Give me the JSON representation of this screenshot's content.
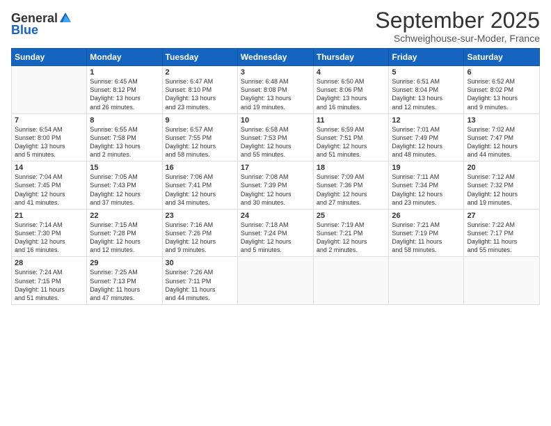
{
  "logo": {
    "general": "General",
    "blue": "Blue"
  },
  "header": {
    "month": "September 2025",
    "location": "Schweighouse-sur-Moder, France"
  },
  "days_of_week": [
    "Sunday",
    "Monday",
    "Tuesday",
    "Wednesday",
    "Thursday",
    "Friday",
    "Saturday"
  ],
  "weeks": [
    [
      {
        "day": "",
        "content": ""
      },
      {
        "day": "1",
        "content": "Sunrise: 6:45 AM\nSunset: 8:12 PM\nDaylight: 13 hours\nand 26 minutes."
      },
      {
        "day": "2",
        "content": "Sunrise: 6:47 AM\nSunset: 8:10 PM\nDaylight: 13 hours\nand 23 minutes."
      },
      {
        "day": "3",
        "content": "Sunrise: 6:48 AM\nSunset: 8:08 PM\nDaylight: 13 hours\nand 19 minutes."
      },
      {
        "day": "4",
        "content": "Sunrise: 6:50 AM\nSunset: 8:06 PM\nDaylight: 13 hours\nand 16 minutes."
      },
      {
        "day": "5",
        "content": "Sunrise: 6:51 AM\nSunset: 8:04 PM\nDaylight: 13 hours\nand 12 minutes."
      },
      {
        "day": "6",
        "content": "Sunrise: 6:52 AM\nSunset: 8:02 PM\nDaylight: 13 hours\nand 9 minutes."
      }
    ],
    [
      {
        "day": "7",
        "content": "Sunrise: 6:54 AM\nSunset: 8:00 PM\nDaylight: 13 hours\nand 5 minutes."
      },
      {
        "day": "8",
        "content": "Sunrise: 6:55 AM\nSunset: 7:58 PM\nDaylight: 13 hours\nand 2 minutes."
      },
      {
        "day": "9",
        "content": "Sunrise: 6:57 AM\nSunset: 7:55 PM\nDaylight: 12 hours\nand 58 minutes."
      },
      {
        "day": "10",
        "content": "Sunrise: 6:58 AM\nSunset: 7:53 PM\nDaylight: 12 hours\nand 55 minutes."
      },
      {
        "day": "11",
        "content": "Sunrise: 6:59 AM\nSunset: 7:51 PM\nDaylight: 12 hours\nand 51 minutes."
      },
      {
        "day": "12",
        "content": "Sunrise: 7:01 AM\nSunset: 7:49 PM\nDaylight: 12 hours\nand 48 minutes."
      },
      {
        "day": "13",
        "content": "Sunrise: 7:02 AM\nSunset: 7:47 PM\nDaylight: 12 hours\nand 44 minutes."
      }
    ],
    [
      {
        "day": "14",
        "content": "Sunrise: 7:04 AM\nSunset: 7:45 PM\nDaylight: 12 hours\nand 41 minutes."
      },
      {
        "day": "15",
        "content": "Sunrise: 7:05 AM\nSunset: 7:43 PM\nDaylight: 12 hours\nand 37 minutes."
      },
      {
        "day": "16",
        "content": "Sunrise: 7:06 AM\nSunset: 7:41 PM\nDaylight: 12 hours\nand 34 minutes."
      },
      {
        "day": "17",
        "content": "Sunrise: 7:08 AM\nSunset: 7:39 PM\nDaylight: 12 hours\nand 30 minutes."
      },
      {
        "day": "18",
        "content": "Sunrise: 7:09 AM\nSunset: 7:36 PM\nDaylight: 12 hours\nand 27 minutes."
      },
      {
        "day": "19",
        "content": "Sunrise: 7:11 AM\nSunset: 7:34 PM\nDaylight: 12 hours\nand 23 minutes."
      },
      {
        "day": "20",
        "content": "Sunrise: 7:12 AM\nSunset: 7:32 PM\nDaylight: 12 hours\nand 19 minutes."
      }
    ],
    [
      {
        "day": "21",
        "content": "Sunrise: 7:14 AM\nSunset: 7:30 PM\nDaylight: 12 hours\nand 16 minutes."
      },
      {
        "day": "22",
        "content": "Sunrise: 7:15 AM\nSunset: 7:28 PM\nDaylight: 12 hours\nand 12 minutes."
      },
      {
        "day": "23",
        "content": "Sunrise: 7:16 AM\nSunset: 7:26 PM\nDaylight: 12 hours\nand 9 minutes."
      },
      {
        "day": "24",
        "content": "Sunrise: 7:18 AM\nSunset: 7:24 PM\nDaylight: 12 hours\nand 5 minutes."
      },
      {
        "day": "25",
        "content": "Sunrise: 7:19 AM\nSunset: 7:21 PM\nDaylight: 12 hours\nand 2 minutes."
      },
      {
        "day": "26",
        "content": "Sunrise: 7:21 AM\nSunset: 7:19 PM\nDaylight: 11 hours\nand 58 minutes."
      },
      {
        "day": "27",
        "content": "Sunrise: 7:22 AM\nSunset: 7:17 PM\nDaylight: 11 hours\nand 55 minutes."
      }
    ],
    [
      {
        "day": "28",
        "content": "Sunrise: 7:24 AM\nSunset: 7:15 PM\nDaylight: 11 hours\nand 51 minutes."
      },
      {
        "day": "29",
        "content": "Sunrise: 7:25 AM\nSunset: 7:13 PM\nDaylight: 11 hours\nand 47 minutes."
      },
      {
        "day": "30",
        "content": "Sunrise: 7:26 AM\nSunset: 7:11 PM\nDaylight: 11 hours\nand 44 minutes."
      },
      {
        "day": "",
        "content": ""
      },
      {
        "day": "",
        "content": ""
      },
      {
        "day": "",
        "content": ""
      },
      {
        "day": "",
        "content": ""
      }
    ]
  ]
}
